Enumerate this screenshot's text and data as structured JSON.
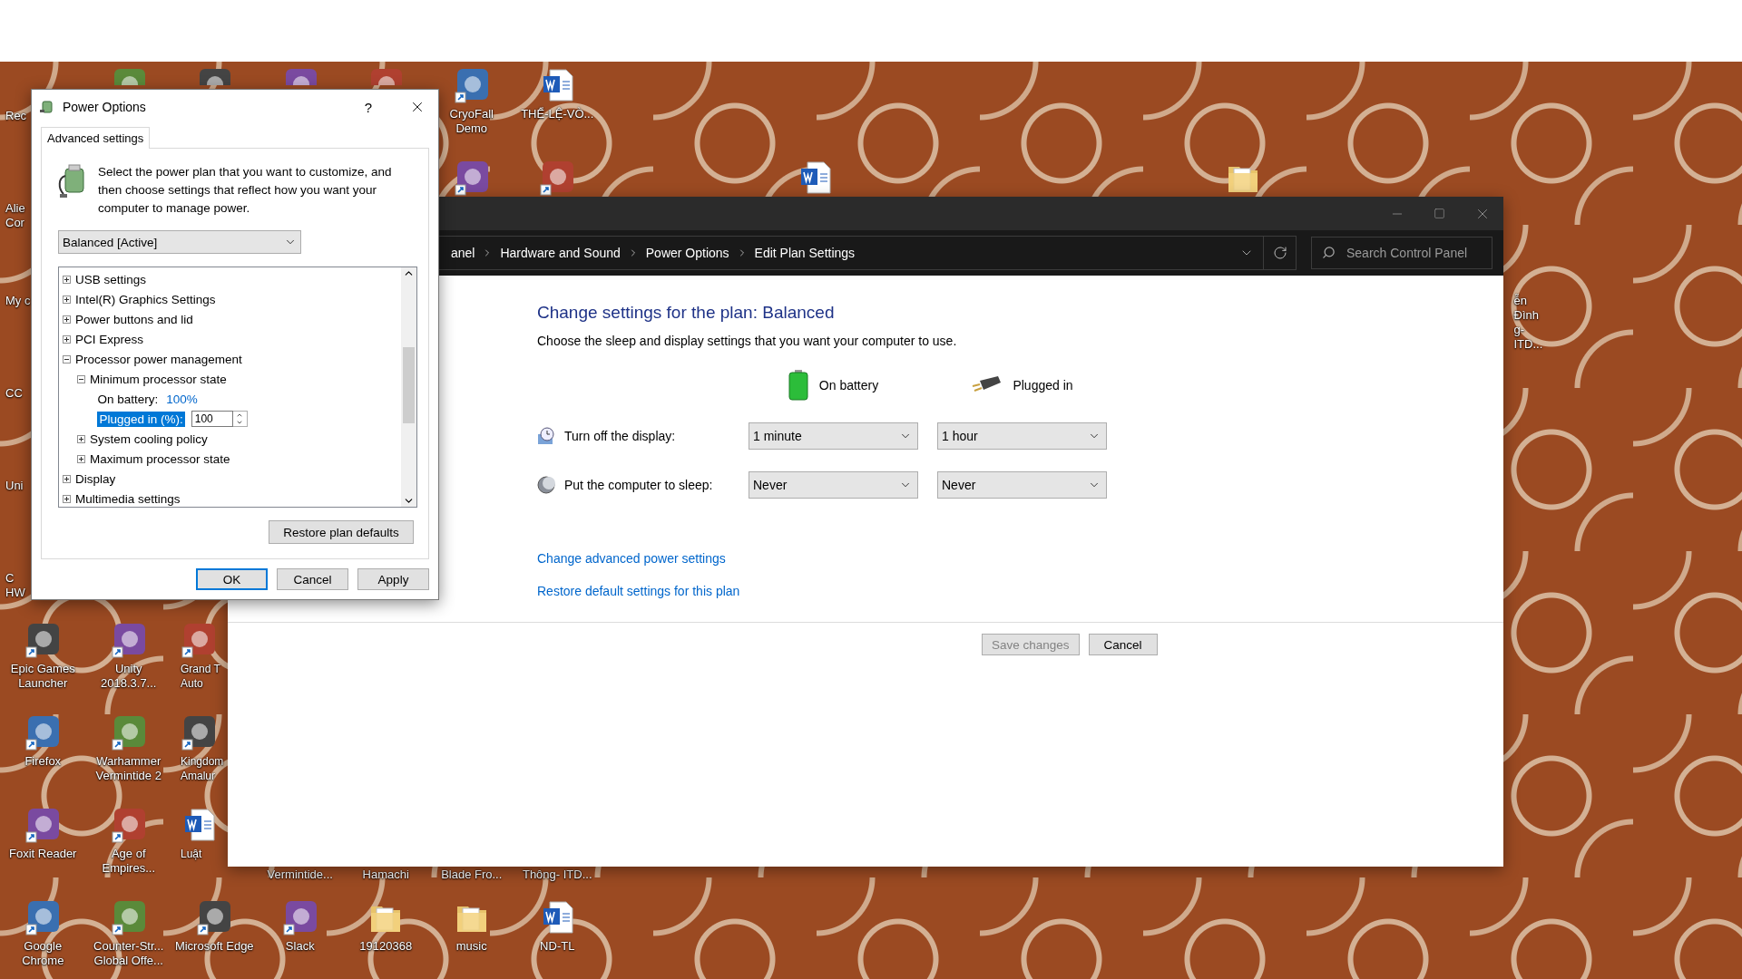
{
  "desktop_icons": [
    {
      "label": "Rec",
      "kind": "cut"
    },
    {
      "kind": "app"
    },
    {
      "kind": "app"
    },
    {
      "kind": "app"
    },
    {
      "kind": "app"
    },
    {
      "label": "CryoFall Demo",
      "kind": "app"
    },
    {
      "label": "THỂ-LỆ-VÒ...",
      "kind": "word"
    },
    {
      "label": "Alie Cor",
      "kind": "cut"
    },
    {
      "kind": "app"
    },
    {
      "kind": "app"
    },
    {
      "kind": "word"
    },
    {
      "kind": "folder"
    },
    {
      "label": "My c",
      "kind": "cut"
    },
    {
      "label": "ễn Đình g- ITD...",
      "kind": "cut"
    },
    {
      "label": "CC",
      "kind": "cut"
    },
    {
      "label": "Uni",
      "kind": "cut"
    },
    {
      "label": "C HW",
      "kind": "cut"
    },
    {
      "label": "Epic Games Launcher",
      "kind": "app"
    },
    {
      "label": "Unity 2018.3.7...",
      "kind": "app"
    },
    {
      "label": "Grand T Auto",
      "kind": "app"
    },
    {
      "label": "Firefox",
      "kind": "app"
    },
    {
      "label": "Warhammer Vermintide 2",
      "kind": "app"
    },
    {
      "label": "Kingdom Amalur",
      "kind": "app"
    },
    {
      "label": "Foxit Reader",
      "kind": "app"
    },
    {
      "label": "Age of Empires...",
      "kind": "app"
    },
    {
      "label": "Luật",
      "kind": "word"
    },
    {
      "label": "Vermintide...",
      "kind": "label"
    },
    {
      "label": "Hamachi",
      "kind": "label"
    },
    {
      "label": "Blade Fro...",
      "kind": "label"
    },
    {
      "label": "Thông- ITD...",
      "kind": "label"
    },
    {
      "label": "Google Chrome",
      "kind": "app"
    },
    {
      "label": "Counter-Str... Global Offe...",
      "kind": "app"
    },
    {
      "label": "Microsoft Edge",
      "kind": "app"
    },
    {
      "label": "Slack",
      "kind": "app"
    },
    {
      "label": "19120368",
      "kind": "folder"
    },
    {
      "label": "music",
      "kind": "folder"
    },
    {
      "label": "ND-TL",
      "kind": "word"
    }
  ],
  "power_options": {
    "title": "Power Options",
    "help": "?",
    "tabs": [
      {
        "label": "Advanced settings",
        "selected": true
      }
    ],
    "intro": "Select the power plan that you want to customize, and then choose settings that reflect how you want your computer to manage power.",
    "plan": "Balanced [Active]",
    "tree": [
      {
        "label": "USB settings",
        "expanded": false
      },
      {
        "label": "Intel(R) Graphics Settings",
        "expanded": false
      },
      {
        "label": "Power buttons and lid",
        "expanded": false
      },
      {
        "label": "PCI Express",
        "expanded": false
      },
      {
        "label": "Processor power management",
        "expanded": true,
        "children": [
          {
            "label": "Minimum processor state",
            "expanded": true,
            "children": [
              {
                "kind": "value",
                "label": "On battery:",
                "value": "100%"
              },
              {
                "kind": "edit",
                "label": "Plugged in (%):",
                "value": "100",
                "selected": true
              }
            ]
          },
          {
            "label": "System cooling policy",
            "expanded": false
          },
          {
            "label": "Maximum processor state",
            "expanded": false
          }
        ]
      },
      {
        "label": "Display",
        "expanded": false
      },
      {
        "label": "Multimedia settings",
        "expanded": false
      }
    ],
    "restore_button": "Restore plan defaults",
    "buttons": [
      {
        "label": "OK",
        "default": true
      },
      {
        "label": "Cancel",
        "default": false
      },
      {
        "label": "Apply",
        "default": false
      }
    ]
  },
  "control_panel": {
    "breadcrumb": [
      "anel",
      "Hardware and Sound",
      "Power Options",
      "Edit Plan Settings"
    ],
    "search": {
      "placeholder": "Search Control Panel"
    },
    "heading": "Change settings for the plan: Balanced",
    "subtitle": "Choose the sleep and display settings that you want your computer to use.",
    "columns": [
      {
        "label": "On battery",
        "kind": "battery"
      },
      {
        "label": "Plugged in",
        "kind": "plug"
      }
    ],
    "settings": [
      {
        "kind": "display",
        "label": "Turn off the display:",
        "values": [
          "1 minute",
          "1 hour"
        ]
      },
      {
        "kind": "sleep",
        "label": "Put the computer to sleep:",
        "values": [
          "Never",
          "Never"
        ]
      }
    ],
    "links": [
      "Change advanced power settings",
      "Restore default settings for this plan"
    ],
    "buttons": [
      {
        "label": "Save changes",
        "disabled": true
      },
      {
        "label": "Cancel",
        "disabled": false
      }
    ]
  }
}
